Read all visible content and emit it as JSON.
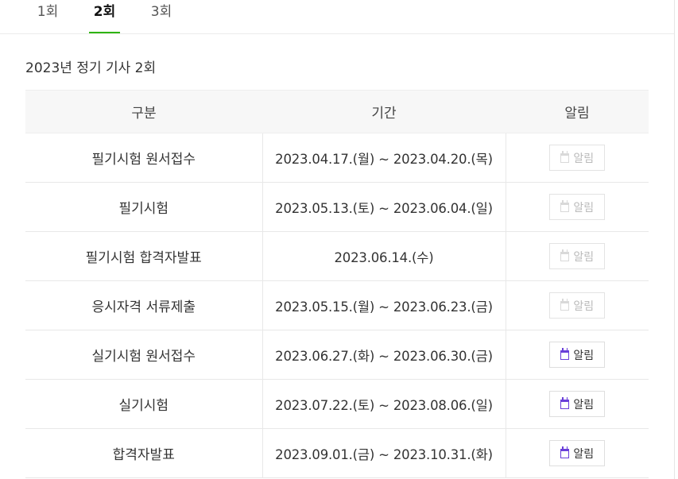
{
  "tabs": [
    {
      "label": "1회",
      "selected": false
    },
    {
      "label": "2회",
      "selected": true
    },
    {
      "label": "3회",
      "selected": false
    }
  ],
  "accent_color": "#2db400",
  "icon_active_color": "#6a3fd9",
  "section_title": "2023년 정기 기사 2회",
  "table": {
    "headers": {
      "type": "구분",
      "period": "기간",
      "alarm": "알림"
    },
    "rows": [
      {
        "type": "필기시험 원서접수",
        "period": "2023.04.17.(월) ~ 2023.04.20.(목)",
        "alarm_label": "알림",
        "alarm_enabled": false,
        "icon": "calendar-icon"
      },
      {
        "type": "필기시험",
        "period": "2023.05.13.(토) ~ 2023.06.04.(일)",
        "alarm_label": "알림",
        "alarm_enabled": false,
        "icon": "calendar-icon"
      },
      {
        "type": "필기시험 합격자발표",
        "period": "2023.06.14.(수)",
        "alarm_label": "알림",
        "alarm_enabled": false,
        "icon": "calendar-icon"
      },
      {
        "type": "응시자격 서류제출",
        "period": "2023.05.15.(월) ~ 2023.06.23.(금)",
        "alarm_label": "알림",
        "alarm_enabled": false,
        "icon": "calendar-icon"
      },
      {
        "type": "실기시험 원서접수",
        "period": "2023.06.27.(화) ~ 2023.06.30.(금)",
        "alarm_label": "알림",
        "alarm_enabled": true,
        "icon": "calendar-icon"
      },
      {
        "type": "실기시험",
        "period": "2023.07.22.(토) ~ 2023.08.06.(일)",
        "alarm_label": "알림",
        "alarm_enabled": true,
        "icon": "calendar-icon"
      },
      {
        "type": "합격자발표",
        "period": "2023.09.01.(금) ~ 2023.10.31.(화)",
        "alarm_label": "알림",
        "alarm_enabled": true,
        "icon": "calendar-icon"
      }
    ]
  }
}
